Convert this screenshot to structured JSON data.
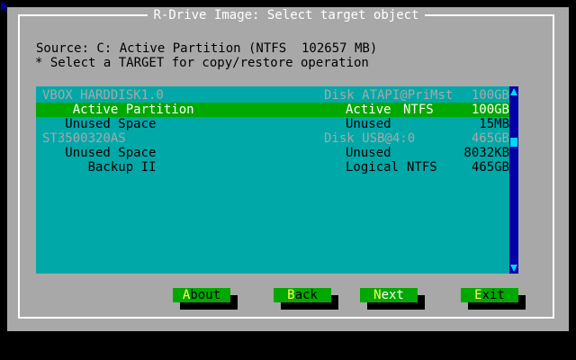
{
  "colors": {
    "screen": "#000000",
    "dialog": "#a8a8a8",
    "list": "#00a8a8",
    "selection": "#00a800",
    "button": "#00a800",
    "hotkey": "#ffff55",
    "scrollbar": "#0000a8"
  },
  "dialog": {
    "title": "R-Drive Image: Select target object",
    "source": "Source: C: Active Partition (NTFS  102657 MB)",
    "instruction": "* Select a TARGET for copy/restore operation"
  },
  "list": {
    "selected_index": 1,
    "rows": [
      {
        "kind": "disk",
        "name": "VBOX HARDDISK1.0",
        "type": "Disk ATAPI@PriMst",
        "fs": "",
        "size": "100GB"
      },
      {
        "kind": "part",
        "name": "    Active Partition",
        "type": "Active",
        "fs": "NTFS",
        "size": "100GB"
      },
      {
        "kind": "part",
        "name": "   Unused Space",
        "type": "Unused",
        "fs": "",
        "size": "15MB"
      },
      {
        "kind": "disk",
        "name": "ST3500320AS",
        "type": "Disk USB@4:0",
        "fs": "",
        "size": "465GB"
      },
      {
        "kind": "part",
        "name": "   Unused Space",
        "type": "Unused",
        "fs": "",
        "size": "8032KB"
      },
      {
        "kind": "part",
        "name": "      Backup II",
        "type": "Logical",
        "fs": "NTFS",
        "size": "465GB"
      }
    ],
    "scrollbar": {
      "up_icon": "arrow-up-icon",
      "down_icon": "arrow-down-icon",
      "position": 0.25
    }
  },
  "buttons": [
    {
      "id": "about",
      "hotkey": "A",
      "rest": "bout",
      "focused": false
    },
    {
      "id": "back",
      "hotkey": "B",
      "rest": "ack",
      "focused": false
    },
    {
      "id": "next",
      "hotkey": "N",
      "rest": "ext",
      "focused": true
    },
    {
      "id": "exit",
      "hotkey": "E",
      "rest": "xit",
      "focused": false,
      "prefix": ""
    }
  ]
}
